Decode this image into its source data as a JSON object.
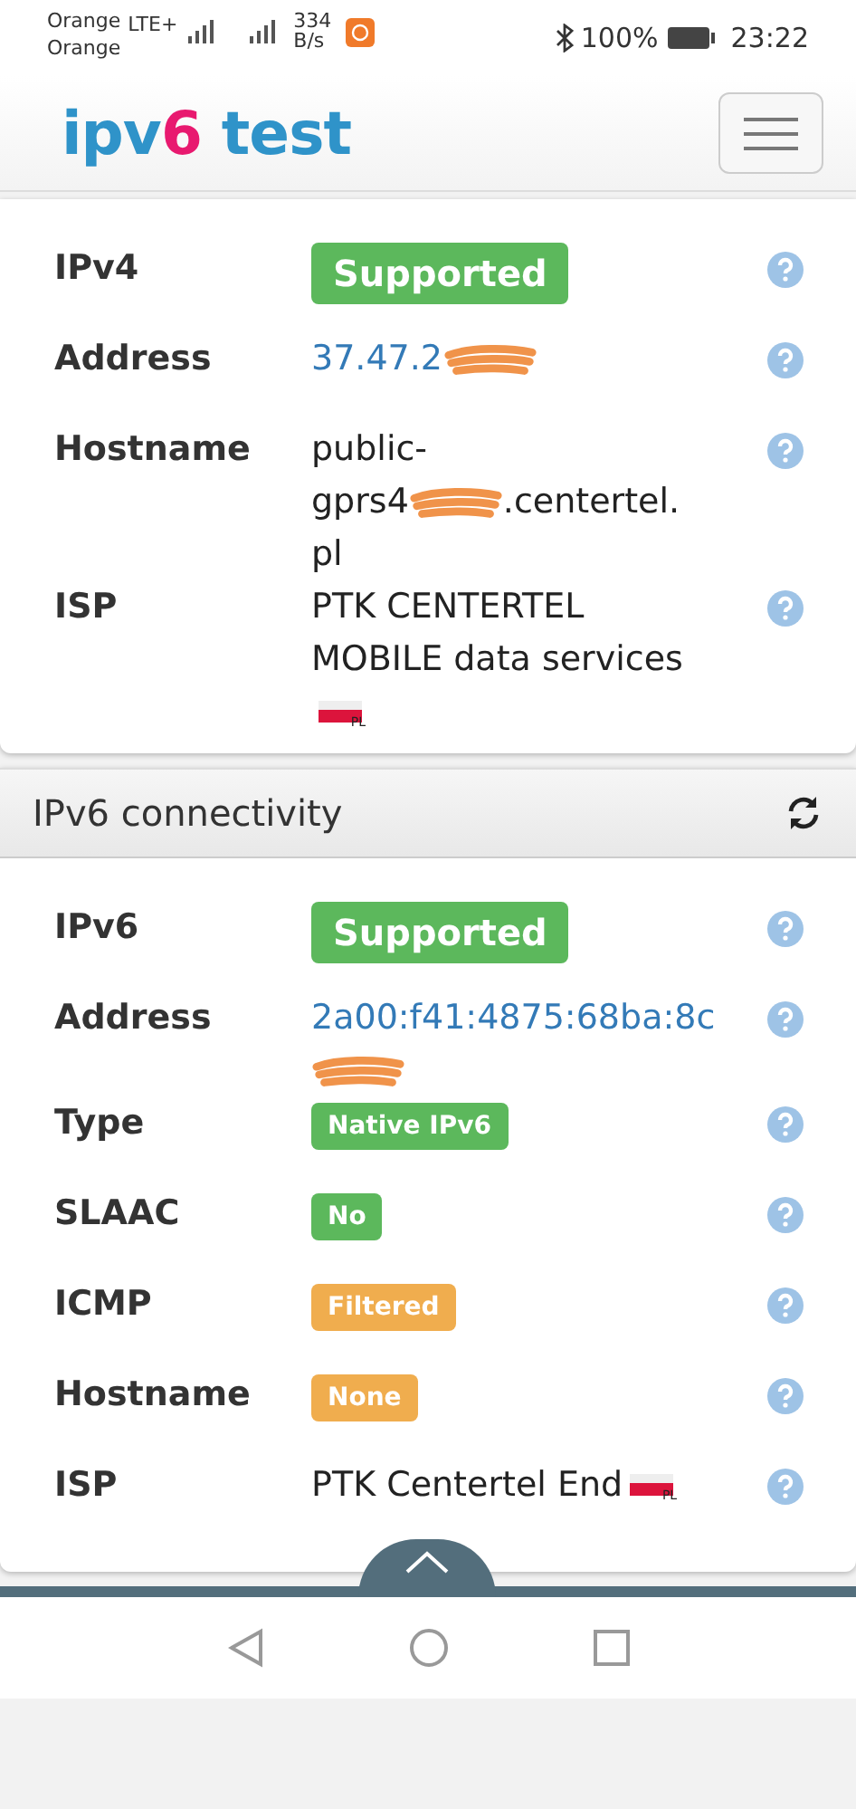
{
  "status_bar": {
    "carrier_1": "Orange",
    "carrier_2": "Orange",
    "network_type": "LTE+",
    "speed_value": "334",
    "speed_unit": "B/s",
    "battery": "100%",
    "time": "23:22"
  },
  "navbar": {
    "logo": [
      {
        "text": "ipv",
        "kind": "plain"
      },
      {
        "text": "6",
        "kind": "accent"
      },
      {
        "text": " test",
        "kind": "plain"
      }
    ]
  },
  "ipv4_card": {
    "rows": [
      {
        "label": "IPv4",
        "kind": "verdict",
        "value": "Supported"
      },
      {
        "label": "Address",
        "kind": "link",
        "parts": [
          {
            "kind": "text",
            "text": "37.47.2"
          },
          {
            "kind": "redacted"
          }
        ]
      },
      {
        "label": "Hostname",
        "kind": "text",
        "parts": [
          {
            "kind": "text",
            "text": "public-"
          },
          {
            "kind": "break"
          },
          {
            "kind": "text",
            "text": "gprs4"
          },
          {
            "kind": "redacted"
          },
          {
            "kind": "text",
            "text": ".centertel."
          },
          {
            "kind": "break"
          },
          {
            "kind": "text",
            "text": "pl"
          }
        ]
      },
      {
        "label": "ISP",
        "kind": "text",
        "parts": [
          {
            "kind": "text",
            "text": "PTK CENTERTEL MOBILE data services"
          },
          {
            "kind": "break"
          },
          {
            "kind": "flag",
            "code": "PL"
          }
        ]
      }
    ]
  },
  "ipv6_card": {
    "title": "IPv6 connectivity",
    "rows": [
      {
        "label": "IPv6",
        "kind": "verdict",
        "value": "Supported"
      },
      {
        "label": "Address",
        "kind": "link",
        "parts": [
          {
            "kind": "text",
            "text": "2a00:f41:4875:68ba:8c"
          },
          {
            "kind": "break"
          },
          {
            "kind": "redacted"
          }
        ]
      },
      {
        "label": "Type",
        "kind": "tag",
        "value": "Native IPv6"
      },
      {
        "label": "SLAAC",
        "kind": "tag",
        "value": "No"
      },
      {
        "label": "ICMP",
        "kind": "alert",
        "value": "Filtered"
      },
      {
        "label": "Hostname",
        "kind": "alert",
        "value": "None"
      },
      {
        "label": "ISP",
        "kind": "text",
        "parts": [
          {
            "kind": "text",
            "text": "PTK Centertel End"
          },
          {
            "kind": "flag",
            "code": "PL"
          }
        ]
      }
    ]
  }
}
